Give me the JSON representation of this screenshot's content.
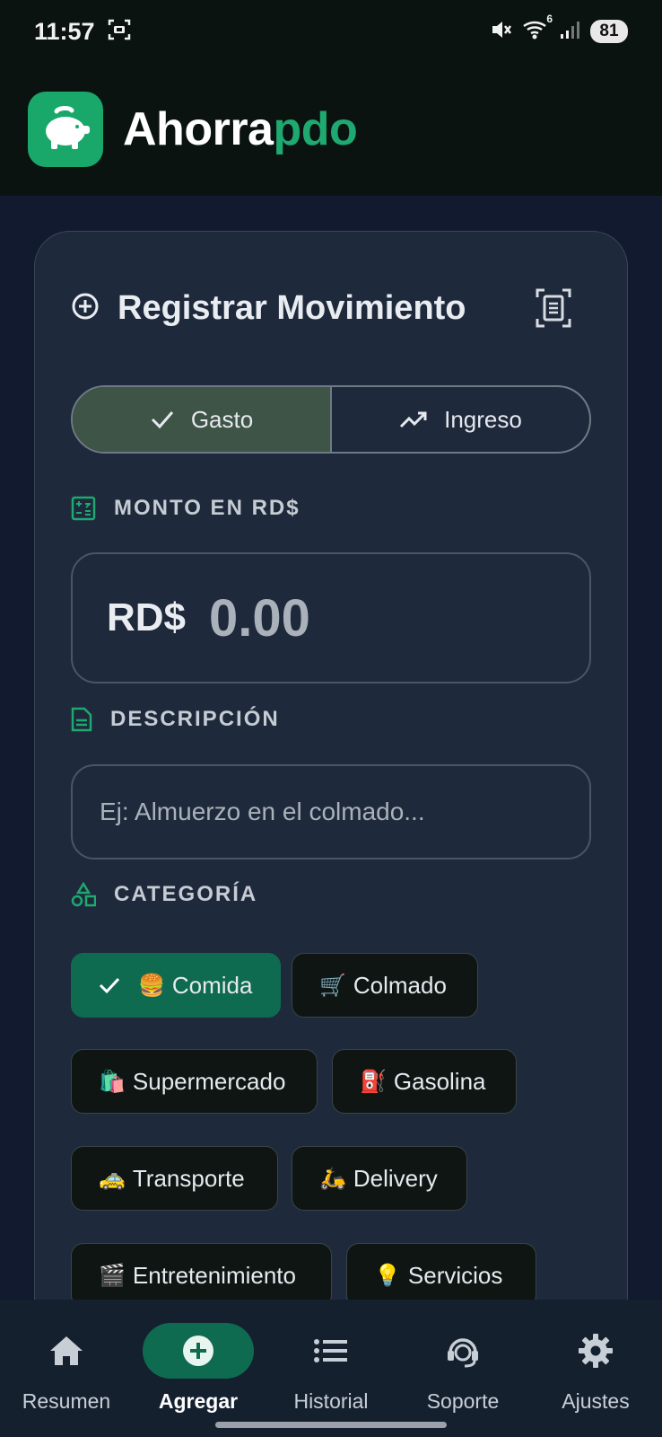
{
  "status_bar": {
    "time": "11:57",
    "battery": "81",
    "network_badge": "6"
  },
  "app": {
    "brand_part1": "Ahorra",
    "brand_part2": "pdo",
    "brand_color": "#1fa870",
    "logo_icon": "piggy-bank-icon"
  },
  "form": {
    "title": "Registrar Movimiento",
    "title_icon": "add-circle-icon",
    "scan_icon": "document-scan-icon",
    "type_toggle": {
      "expense_label": "Gasto",
      "income_label": "Ingreso",
      "selected": "Gasto"
    },
    "amount": {
      "label": "MONTO EN RD$",
      "currency": "RD$",
      "value": "0.00"
    },
    "description": {
      "label": "DESCRIPCIÓN",
      "placeholder": "Ej: Almuerzo en el colmado...",
      "value": ""
    },
    "category": {
      "label": "CATEGORÍA",
      "selected": "Comida",
      "items": [
        {
          "emoji": "🍔",
          "label": "Comida"
        },
        {
          "emoji": "🛒",
          "label": "Colmado"
        },
        {
          "emoji": "🛍️",
          "label": "Supermercado"
        },
        {
          "emoji": "⛽",
          "label": "Gasolina"
        },
        {
          "emoji": "🚕",
          "label": "Transporte"
        },
        {
          "emoji": "🛵",
          "label": "Delivery"
        },
        {
          "emoji": "🎬",
          "label": "Entretenimiento"
        },
        {
          "emoji": "💡",
          "label": "Servicios"
        }
      ]
    }
  },
  "bottom_nav": {
    "active": "Agregar",
    "items": [
      {
        "label": "Resumen",
        "icon": "home-icon"
      },
      {
        "label": "Agregar",
        "icon": "add-circle-icon"
      },
      {
        "label": "Historial",
        "icon": "list-icon"
      },
      {
        "label": "Soporte",
        "icon": "support-agent-icon"
      },
      {
        "label": "Ajustes",
        "icon": "gear-icon"
      }
    ]
  },
  "colors": {
    "accent": "#0f6b4f",
    "background": "#111a2e",
    "card": "#1e293b",
    "header": "#0b1310"
  }
}
